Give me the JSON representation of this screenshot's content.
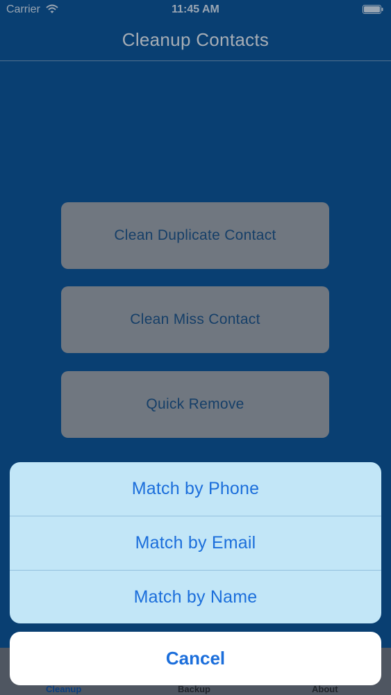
{
  "status_bar": {
    "carrier": "Carrier",
    "time": "11:45 AM",
    "icons": [
      "wifi-icon",
      "battery-icon"
    ]
  },
  "nav": {
    "title": "Cleanup Contacts"
  },
  "main": {
    "buttons": [
      {
        "label": "Clean Duplicate Contact"
      },
      {
        "label": "Clean Miss Contact"
      },
      {
        "label": "Quick Remove"
      }
    ]
  },
  "tab_bar": {
    "items": [
      {
        "label": "Cleanup",
        "selected": true
      },
      {
        "label": "Backup",
        "selected": false
      },
      {
        "label": "About",
        "selected": false
      }
    ]
  },
  "action_sheet": {
    "options": [
      {
        "label": "Match by Phone"
      },
      {
        "label": "Match by Email"
      },
      {
        "label": "Match by Name"
      }
    ],
    "cancel_label": "Cancel"
  },
  "colors": {
    "background": "#093f72",
    "accent": "#1b6edb",
    "sheet_background": "#c2e6f7",
    "selected_tab": "#0b3f80",
    "unselected_tab": "#1f242b"
  }
}
